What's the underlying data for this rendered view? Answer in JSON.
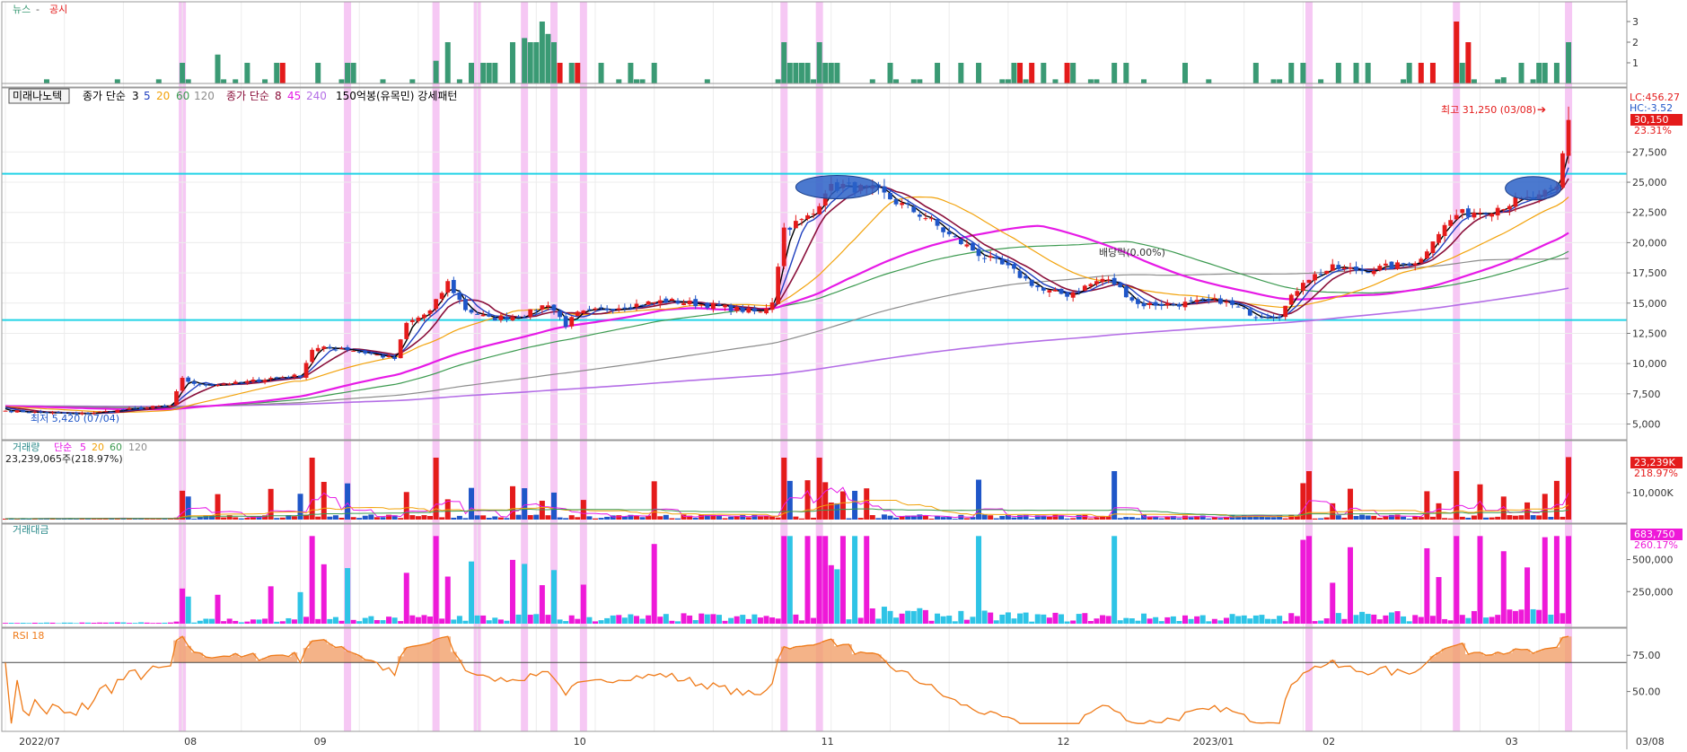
{
  "colors": {
    "up": "#e41b1b",
    "down": "#1f56c8",
    "news": "#3a9a74",
    "disclosure": "#e41b1b",
    "highlight": "#f6c8f4",
    "hline": "#22d3e6",
    "ma3": "#000000",
    "ma5": "#1f3fbf",
    "ma20": "#f2a20a",
    "ma60": "#3c9a50",
    "ma120": "#8c8c8c",
    "ma8": "#8a0f3a",
    "ma45": "#e61ae6",
    "ma240": "#b46ee6",
    "rsi": "#ef7a18",
    "vol_cyan": "#2ec4e6",
    "amt_magenta": "#ee19d8"
  },
  "news_panel": {
    "legend_news": "뉴스",
    "legend_sep": "-",
    "legend_disclosure": "공시",
    "axis_ticks": [
      "3",
      "2",
      "1"
    ]
  },
  "price_panel": {
    "stock_name": "미래나노텍",
    "legend_ma_close": "종가 단순",
    "legend_ma_close_periods": [
      "3",
      "5",
      "20",
      "60",
      "120"
    ],
    "legend_ma_close2": "종가 단순",
    "legend_ma_close2_periods": [
      "8",
      "45",
      "240"
    ],
    "legend_pattern": "150억봉(유목민) 강세패턴",
    "lc": "LC:456.27",
    "hc": "HC:-3.52",
    "current_price": "30,150",
    "current_change": "23.31%",
    "high_label": "최고 31,250 (03/08)",
    "low_label": "최저 5,420 (07/04)",
    "exdiv_label": "배당락(0.00%)",
    "axis_ticks": [
      "27,500",
      "25,000",
      "22,500",
      "20,000",
      "17,500",
      "15,000",
      "12,500",
      "10,000",
      "7,500",
      "5,000"
    ]
  },
  "volume_panel": {
    "title": "거래량",
    "legend_ma": "단순",
    "legend_periods": [
      "5",
      "20",
      "60",
      "120"
    ],
    "value_text": "23,239,065주(218.97%)",
    "current": "23,239K",
    "current_pct": "218.97%",
    "axis_ticks": [
      "10,000K"
    ]
  },
  "amount_panel": {
    "title": "거래대금",
    "current": "683,750",
    "current_pct": "260.17%",
    "axis_ticks": [
      "500,000",
      "250,000"
    ]
  },
  "rsi_panel": {
    "title": "RSI 18",
    "axis_ticks": [
      "75.00",
      "50.00"
    ]
  },
  "x_axis": {
    "labels": [
      "2022/07",
      "08",
      "09",
      "10",
      "11",
      "12",
      "2023/01",
      "02",
      "03",
      "03/08"
    ]
  },
  "chart_data": {
    "type": "candlestick",
    "price_range": [
      4000,
      32500
    ],
    "resistance_lines": [
      25700,
      13600
    ],
    "anchors": [
      [
        0,
        6100
      ],
      [
        12,
        5800
      ],
      [
        25,
        6400
      ],
      [
        28,
        6500
      ],
      [
        30,
        8700
      ],
      [
        33,
        8200
      ],
      [
        40,
        8400
      ],
      [
        45,
        8800
      ],
      [
        50,
        9000
      ],
      [
        52,
        11200
      ],
      [
        57,
        11300
      ],
      [
        60,
        11000
      ],
      [
        66,
        10400
      ],
      [
        68,
        13300
      ],
      [
        72,
        14300
      ],
      [
        75,
        16700
      ],
      [
        78,
        14500
      ],
      [
        82,
        13700
      ],
      [
        88,
        14000
      ],
      [
        92,
        15000
      ],
      [
        95,
        13200
      ],
      [
        97,
        14100
      ],
      [
        104,
        14700
      ],
      [
        112,
        15200
      ],
      [
        120,
        14800
      ],
      [
        128,
        14200
      ],
      [
        130,
        15200
      ],
      [
        132,
        21200
      ],
      [
        135,
        21800
      ],
      [
        137,
        22400
      ],
      [
        139,
        24400
      ],
      [
        142,
        24700
      ],
      [
        148,
        24200
      ],
      [
        152,
        23100
      ],
      [
        156,
        22100
      ],
      [
        160,
        20600
      ],
      [
        166,
        18800
      ],
      [
        170,
        17900
      ],
      [
        176,
        16000
      ],
      [
        180,
        15700
      ],
      [
        186,
        17000
      ],
      [
        188,
        16600
      ],
      [
        192,
        14900
      ],
      [
        198,
        14900
      ],
      [
        206,
        15200
      ],
      [
        212,
        14000
      ],
      [
        216,
        14000
      ],
      [
        220,
        16900
      ],
      [
        225,
        17900
      ],
      [
        230,
        17700
      ],
      [
        236,
        18100
      ],
      [
        240,
        18600
      ],
      [
        242,
        20400
      ],
      [
        246,
        22300
      ],
      [
        252,
        22800
      ],
      [
        256,
        23400
      ],
      [
        260,
        23700
      ],
      [
        263,
        24500
      ],
      [
        265,
        30150
      ]
    ],
    "volume_spikes": [
      30,
      31,
      36,
      45,
      50,
      52,
      54,
      58,
      68,
      73,
      75,
      79,
      86,
      88,
      91,
      93,
      98,
      110,
      132,
      133,
      136,
      138,
      139,
      140,
      141,
      142,
      144,
      146,
      165,
      188,
      220,
      221,
      225,
      228,
      241,
      243,
      246,
      250,
      254,
      258,
      261,
      263,
      265
    ],
    "news_days": [
      30,
      36,
      41,
      46,
      53,
      58,
      59,
      73,
      75,
      79,
      81,
      82,
      83,
      86,
      88,
      89,
      90,
      91,
      92,
      93,
      96,
      97,
      101,
      106,
      110,
      132,
      133,
      134,
      135,
      136,
      138,
      139,
      140,
      141,
      150,
      158,
      162,
      165,
      171,
      174,
      176,
      181,
      188,
      190,
      200,
      212,
      218,
      220,
      226,
      229,
      231,
      238,
      242,
      246,
      247,
      254,
      257,
      260,
      261,
      263,
      265
    ],
    "disclosure_days": [
      47,
      94,
      97,
      172,
      174,
      180,
      240,
      242,
      246,
      248
    ],
    "highlight_days": [
      30,
      58,
      73,
      80,
      88,
      93,
      98,
      132,
      138,
      221,
      246,
      265
    ]
  }
}
